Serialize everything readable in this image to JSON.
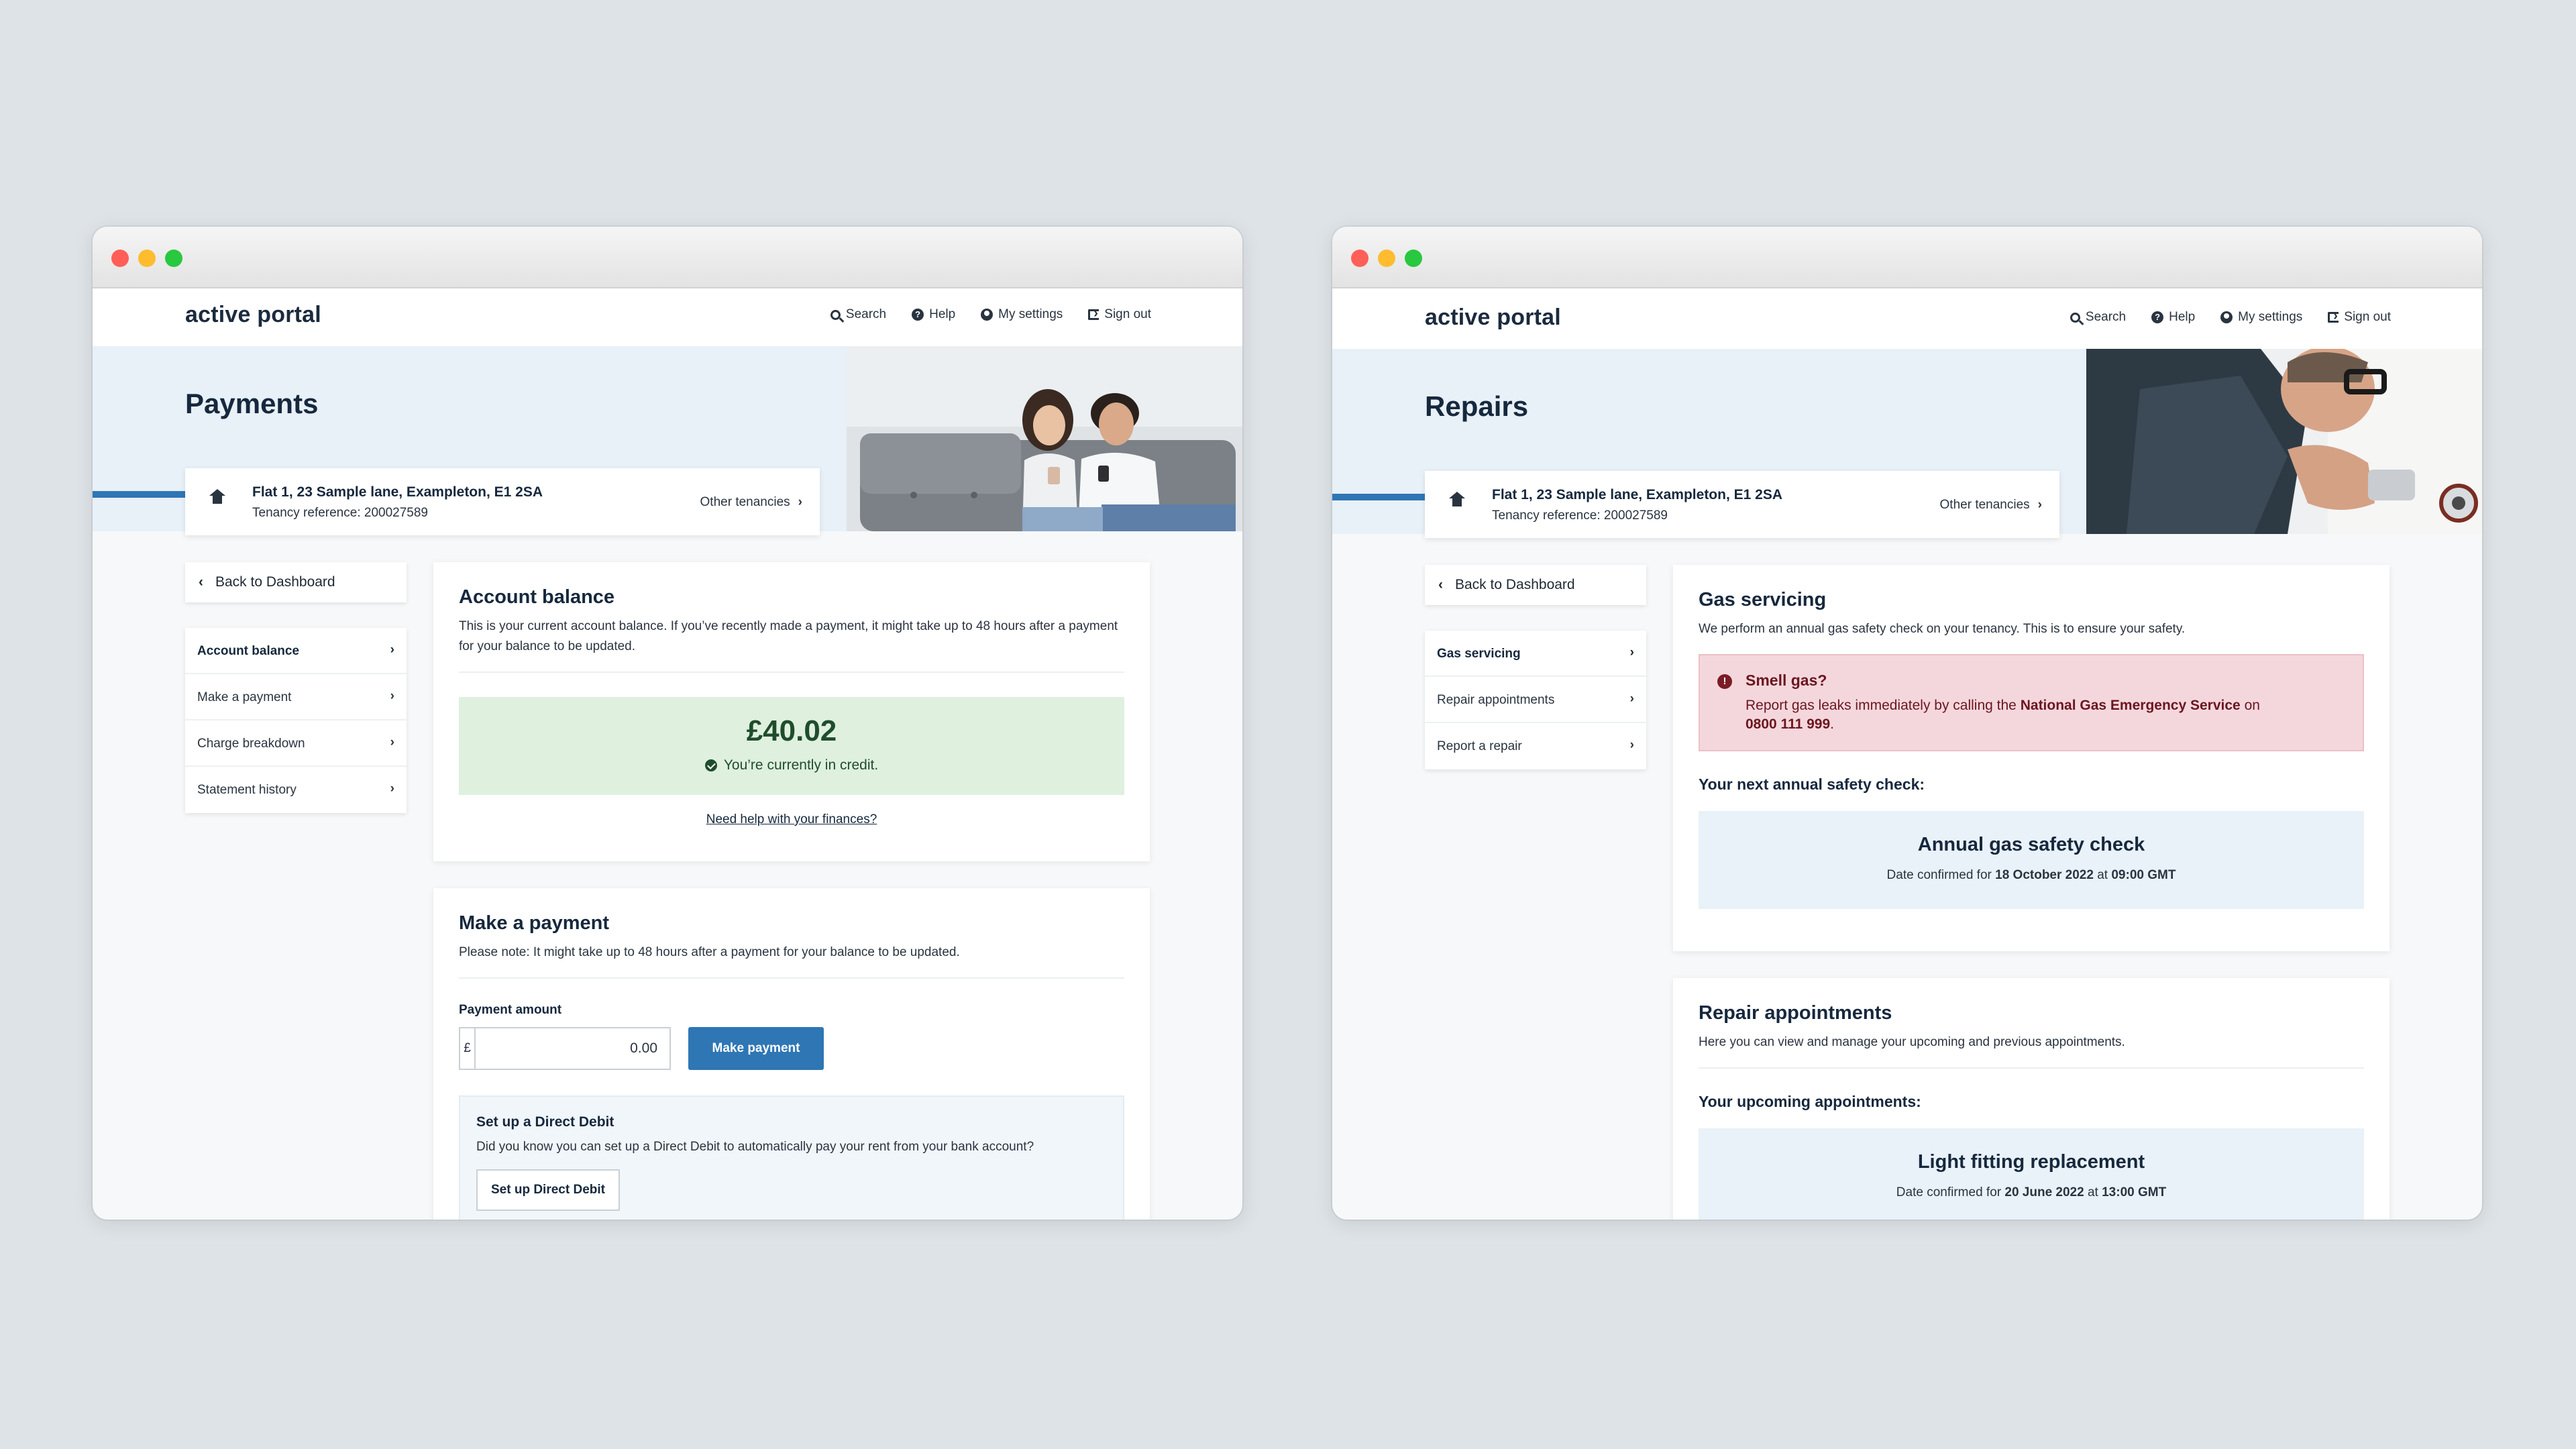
{
  "colors": {
    "accent": "#2f76b5",
    "hero_bg": "#e8f0f8",
    "success_bg": "#dff0df",
    "alert_bg": "#f4d7dc",
    "info_bg": "#e9f1f9"
  },
  "nav": {
    "logo": "active portal",
    "links": [
      {
        "label": "Search",
        "icon": "search-icon"
      },
      {
        "label": "Help",
        "icon": "help-icon"
      },
      {
        "label": "My settings",
        "icon": "user-icon"
      },
      {
        "label": "Sign out",
        "icon": "sign-out-icon"
      }
    ]
  },
  "tenancy": {
    "address": "Flat 1, 23 Sample lane, Exampleton, E1 2SA",
    "reference": "Tenancy reference: 200027589",
    "other": "Other tenancies"
  },
  "back_label": "Back to Dashboard",
  "payments": {
    "title": "Payments",
    "sidenav": [
      "Account balance",
      "Make a payment",
      "Charge breakdown",
      "Statement history"
    ],
    "balance": {
      "title": "Account balance",
      "text": "This is your current account balance. If you’ve recently made a payment, it might take up to 48 hours after a payment for your balance to be updated.",
      "amount": "£40.02",
      "status": "You’re currently in credit.",
      "help_link": "Need help with your finances?"
    },
    "make_payment": {
      "title": "Make a payment",
      "text": "Please note: It might take up to 48 hours after a payment for your balance to be updated.",
      "amount_label": "Payment amount",
      "currency": "£",
      "amount_value": "0.00",
      "button": "Make payment"
    },
    "direct_debit": {
      "title": "Set up a Direct Debit",
      "text": "Did you know you can set up a Direct Debit to automatically pay your rent from your bank account?",
      "button": "Set up Direct Debit"
    }
  },
  "repairs": {
    "title": "Repairs",
    "sidenav": [
      "Gas servicing",
      "Repair appointments",
      "Report a repair"
    ],
    "gas": {
      "title": "Gas servicing",
      "text": "We perform an annual gas safety check on your tenancy. This is to ensure your safety.",
      "alert_title": "Smell gas?",
      "alert_text_1": "Report gas leaks immediately by calling the",
      "alert_service": "National Gas Emergency Service",
      "alert_text_2": "on",
      "alert_phone": "0800 111 999",
      "next_check_label": "Your next annual safety check:",
      "check_title": "Annual gas safety check",
      "check_date_prefix": "Date confirmed for",
      "check_date": "18 October 2022",
      "check_at": "at",
      "check_time": "09:00 GMT"
    },
    "appointments": {
      "title": "Repair appointments",
      "text": "Here you can view and manage your upcoming and previous appointments.",
      "upcoming_label": "Your upcoming appointments:",
      "appt_title": "Light fitting replacement",
      "appt_date_prefix": "Date confirmed for",
      "appt_date": "20 June 2022",
      "appt_at": "at",
      "appt_time": "13:00 GMT"
    }
  }
}
